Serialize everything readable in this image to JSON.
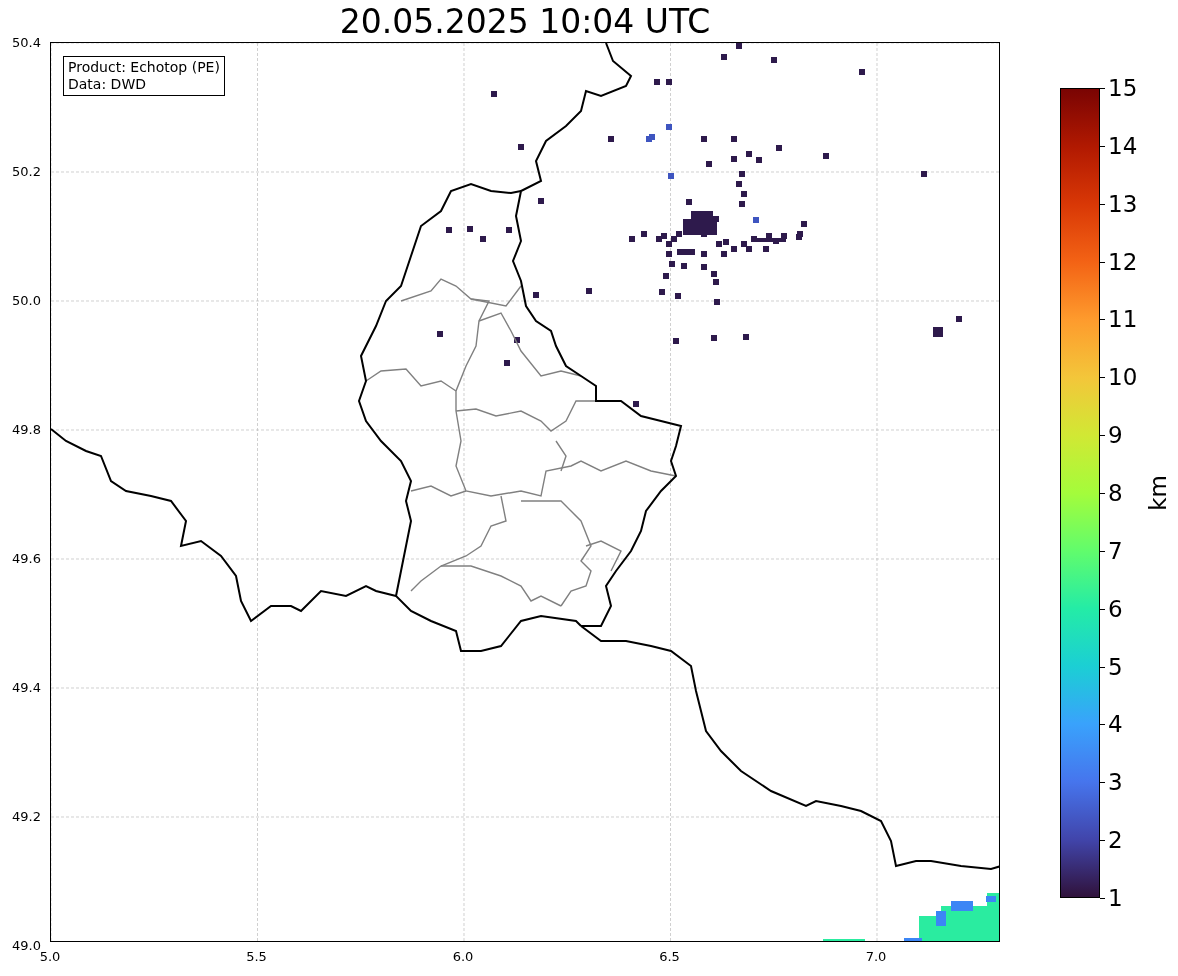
{
  "title": "20.05.2025 10:04 UTC",
  "info_box": [
    "Product: Echotop (PE)",
    "Data: DWD"
  ],
  "x_ticks": [
    "5.0",
    "5.5",
    "6.0",
    "6.5",
    "7.0"
  ],
  "y_ticks": [
    "50.4",
    "50.2",
    "50.0",
    "49.8",
    "49.6",
    "49.4",
    "49.2",
    "49.0"
  ],
  "colorbar": {
    "ticks": [
      "15",
      "14",
      "13",
      "12",
      "11",
      "10",
      "9",
      "8",
      "7",
      "6",
      "5",
      "4",
      "3",
      "2",
      "1"
    ],
    "label": "km"
  }
}
